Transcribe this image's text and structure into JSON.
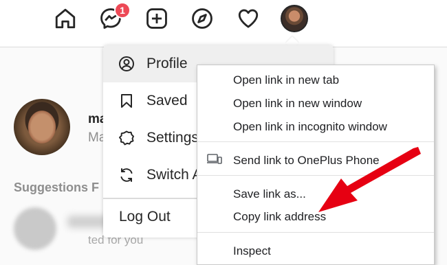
{
  "nav": {
    "icons": [
      "home-icon",
      "messenger-icon",
      "new-post-icon",
      "explore-icon",
      "activity-icon"
    ],
    "messenger_badge": "1",
    "badge_color": "#ed4956"
  },
  "sidebar": {
    "username": "ma",
    "fullname": "Ma",
    "suggestions_heading": "Suggestions F",
    "suggested_text": "ted for you"
  },
  "profile_menu": {
    "items": [
      {
        "label": "Profile",
        "icon": "profile-icon"
      },
      {
        "label": "Saved",
        "icon": "bookmark-icon"
      },
      {
        "label": "Settings",
        "icon": "gear-icon"
      },
      {
        "label": "Switch A",
        "icon": "switch-accounts-icon"
      }
    ],
    "logout_label": "Log Out"
  },
  "context_menu": {
    "group1": [
      "Open link in new tab",
      "Open link in new window",
      "Open link in incognito window"
    ],
    "send_label": "Send link to OnePlus Phone",
    "group3": [
      "Save link as...",
      "Copy link address"
    ],
    "inspect_label": "Inspect"
  },
  "colors": {
    "annotation_arrow": "#e60012",
    "hover_bg": "#efefef"
  }
}
